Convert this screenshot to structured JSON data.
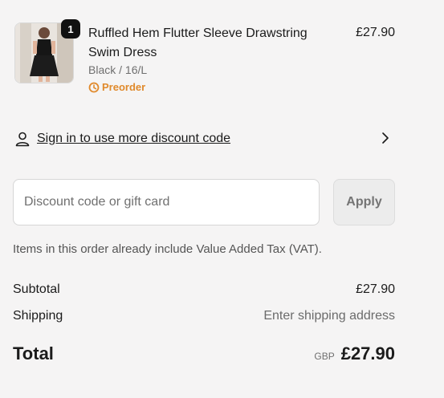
{
  "product": {
    "quantity": "1",
    "title": "Ruffled Hem Flutter Sleeve Drawstring Swim Dress",
    "variant": "Black / 16/L",
    "status": "Preorder",
    "price": "£27.90",
    "status_color": "#e08a2c"
  },
  "signin": {
    "label": "Sign in to use more discount code"
  },
  "discount": {
    "placeholder": "Discount code or gift card",
    "apply_label": "Apply"
  },
  "vat_note": "Items in this order already include Value Added Tax (VAT).",
  "summary": {
    "subtotal_label": "Subtotal",
    "subtotal_value": "£27.90",
    "shipping_label": "Shipping",
    "shipping_value": "Enter shipping address",
    "total_label": "Total",
    "total_currency": "GBP",
    "total_value": "£27.90"
  },
  "icons": {
    "user": "user-icon",
    "chevron": "chevron-right-icon",
    "preorder": "preorder-clock-icon"
  }
}
